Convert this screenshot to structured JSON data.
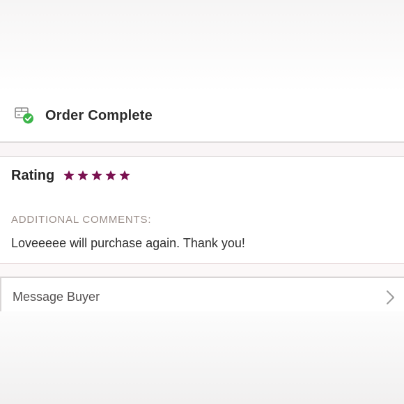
{
  "order_status": {
    "title": "Order Complete",
    "icon": "package-check-icon",
    "icon_accent": "#3cb54a"
  },
  "review": {
    "rating_label": "Rating",
    "rating_value": 5,
    "rating_max": 5,
    "star_color": "#7a1150",
    "comments_label": "ADDITIONAL COMMENTS:",
    "comment": "Loveeeee will purchase again. Thank you!"
  },
  "actions": {
    "message_buyer_label": "Message Buyer",
    "chevron_icon": "chevron-right-icon"
  }
}
